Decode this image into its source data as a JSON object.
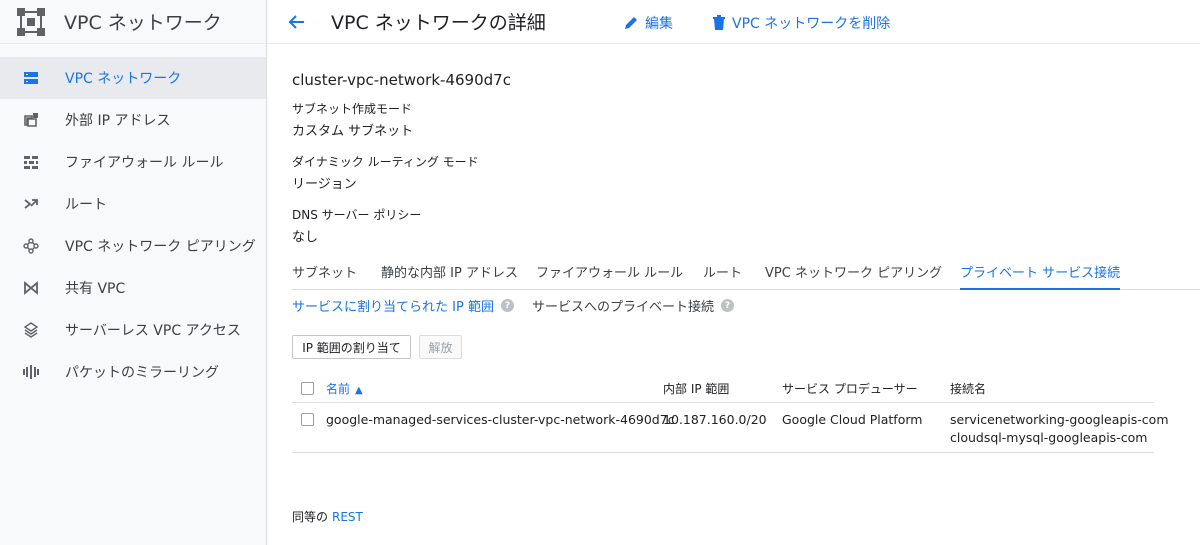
{
  "sidebar": {
    "title": "VPC ネットワーク",
    "items": [
      {
        "label": "VPC ネットワーク",
        "icon": "vpc-network-icon",
        "active": true
      },
      {
        "label": "外部 IP アドレス",
        "icon": "external-ip-icon",
        "active": false
      },
      {
        "label": "ファイアウォール ルール",
        "icon": "firewall-icon",
        "active": false
      },
      {
        "label": "ルート",
        "icon": "routes-icon",
        "active": false
      },
      {
        "label": "VPC ネットワーク ピアリング",
        "icon": "peering-icon",
        "active": false
      },
      {
        "label": "共有 VPC",
        "icon": "shared-vpc-icon",
        "active": false
      },
      {
        "label": "サーバーレス VPC アクセス",
        "icon": "serverless-vpc-icon",
        "active": false
      },
      {
        "label": "パケットのミラーリング",
        "icon": "packet-mirroring-icon",
        "active": false
      }
    ]
  },
  "header": {
    "title": "VPC ネットワークの詳細",
    "edit_label": "編集",
    "delete_label": "VPC ネットワークを削除"
  },
  "network": {
    "name": "cluster-vpc-network-4690d7c",
    "subnet_mode_label": "サブネット作成モード",
    "subnet_mode_value": "カスタム サブネット",
    "routing_mode_label": "ダイナミック ルーティング モード",
    "routing_mode_value": "リージョン",
    "dns_policy_label": "DNS サーバー ポリシー",
    "dns_policy_value": "なし"
  },
  "tabs": [
    {
      "label": "サブネット",
      "active": false
    },
    {
      "label": "静的な内部 IP アドレス",
      "active": false
    },
    {
      "label": "ファイアウォール ルール",
      "active": false
    },
    {
      "label": "ルート",
      "active": false
    },
    {
      "label": "VPC ネットワーク ピアリング",
      "active": false
    },
    {
      "label": "プライベート サービス接続",
      "active": true
    }
  ],
  "subtabs": [
    {
      "label": "サービスに割り当てられた IP 範囲",
      "active": true
    },
    {
      "label": "サービスへのプライベート接続",
      "active": false
    }
  ],
  "buttons": {
    "allocate": "IP 範囲の割り当て",
    "release": "解放"
  },
  "table": {
    "columns": [
      "名前",
      "内部 IP 範囲",
      "サービス プロデューサー",
      "接続名"
    ],
    "rows": [
      {
        "name": "google-managed-services-cluster-vpc-network-4690d7c",
        "ip_range": "10.187.160.0/20",
        "producer": "Google Cloud Platform",
        "connection_1": "servicenetworking-googleapis-com",
        "connection_2": "cloudsql-mysql-googleapis-com"
      }
    ]
  },
  "footer": {
    "prefix": "同等の",
    "link": "REST"
  },
  "colors": {
    "accent": "#1a73e8",
    "sidebar_bg": "#f8f9fa"
  }
}
